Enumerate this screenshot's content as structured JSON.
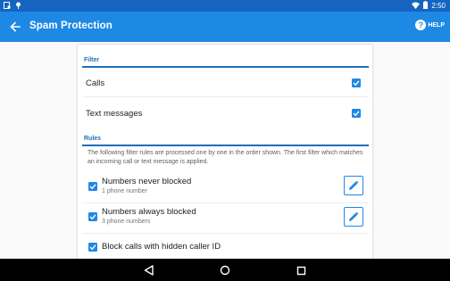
{
  "status_bar": {
    "time": "2:50"
  },
  "app_bar": {
    "title": "Spam Protection",
    "help_label": "HELP"
  },
  "filter": {
    "header": "Filter",
    "items": [
      {
        "label": "Calls",
        "checked": true
      },
      {
        "label": "Text messages",
        "checked": true
      }
    ]
  },
  "rules": {
    "header": "Rules",
    "description": "The following filter rules are processed one by one in the order shown. The first filter which matches an incoming call or text message is applied.",
    "items": [
      {
        "title": "Numbers never blocked",
        "subtitle": "1 phone number",
        "checked": true
      },
      {
        "title": "Numbers always blocked",
        "subtitle": "3 phone numbers",
        "checked": true
      },
      {
        "title": "Block calls with hidden caller ID",
        "checked": true
      }
    ]
  },
  "colors": {
    "status_bar": "#1565c0",
    "app_bar": "#1e88e5",
    "accent": "#1e88e5",
    "section_header": "#1e6fb8"
  }
}
